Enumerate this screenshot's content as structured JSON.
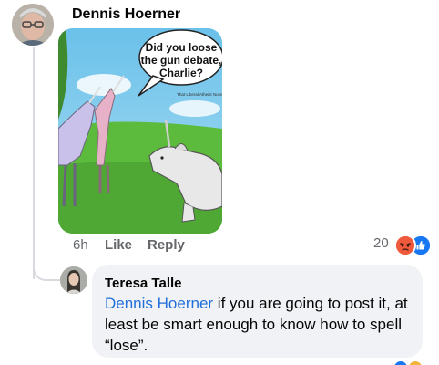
{
  "post": {
    "author": "Dennis Hoerner",
    "image": {
      "speech_text": "Did you loose the gun debate, Charlie?",
      "watermark": "That Liberal Atheist Nurse"
    },
    "time": "6h",
    "like_label": "Like",
    "reply_label": "Reply",
    "reaction_count": "20",
    "reactions": [
      "angry-reaction-icon",
      "like-reaction-icon"
    ]
  },
  "reply": {
    "author": "Teresa Talle",
    "mention": "Dennis Hoerner",
    "text": " if you are going to post it, at least be smart enough to know how to spell “lose”."
  },
  "colors": {
    "link": "#216fdb",
    "bubble": "#f0f2f5",
    "meta": "#65676b",
    "like_blue": "#1877f2",
    "angry": "#f05a3c"
  }
}
